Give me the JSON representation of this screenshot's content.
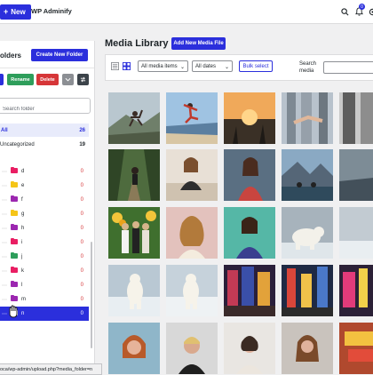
{
  "topbar": {
    "new_label": "New",
    "brand": "WP Adminify",
    "notification_count": "0"
  },
  "folder_panel": {
    "title": "olders",
    "create_label": "Create New Folder",
    "rename_label": "Rename",
    "delete_label": "Delete",
    "search_placeholder": "Search folder",
    "all_label": "All",
    "all_count": "26",
    "uncategorized_label": "Uncategorized",
    "uncategorized_count": "19",
    "folders": [
      {
        "name": "d",
        "count": "0",
        "color": "#e91e63"
      },
      {
        "name": "e",
        "count": "0",
        "color": "#f5c518"
      },
      {
        "name": "f",
        "count": "0",
        "color": "#9c27b0"
      },
      {
        "name": "g",
        "count": "0",
        "color": "#f5c518"
      },
      {
        "name": "h",
        "count": "0",
        "color": "#9c27b0"
      },
      {
        "name": "i",
        "count": "0",
        "color": "#e91e63"
      },
      {
        "name": "j",
        "count": "0",
        "color": "#2e9e5b"
      },
      {
        "name": "k",
        "count": "0",
        "color": "#e91e63"
      },
      {
        "name": "l",
        "count": "0",
        "color": "#9c27b0"
      },
      {
        "name": "m",
        "count": "0",
        "color": "#9c27b0"
      },
      {
        "name": "n",
        "count": "0",
        "color": "#ffffff"
      }
    ],
    "status_url": "oca/wp-admin/upload.php?media_folder=n"
  },
  "colors": {
    "accent": "#2b2fdc",
    "rename": "#2e9e5b",
    "delete": "#d63638"
  },
  "main": {
    "title": "Media Library",
    "add_new_label": "Add New Media File",
    "filter_type": "All media items",
    "filter_date": "All dates",
    "bulk_label": "Bulk select",
    "search_label": "Search media"
  }
}
